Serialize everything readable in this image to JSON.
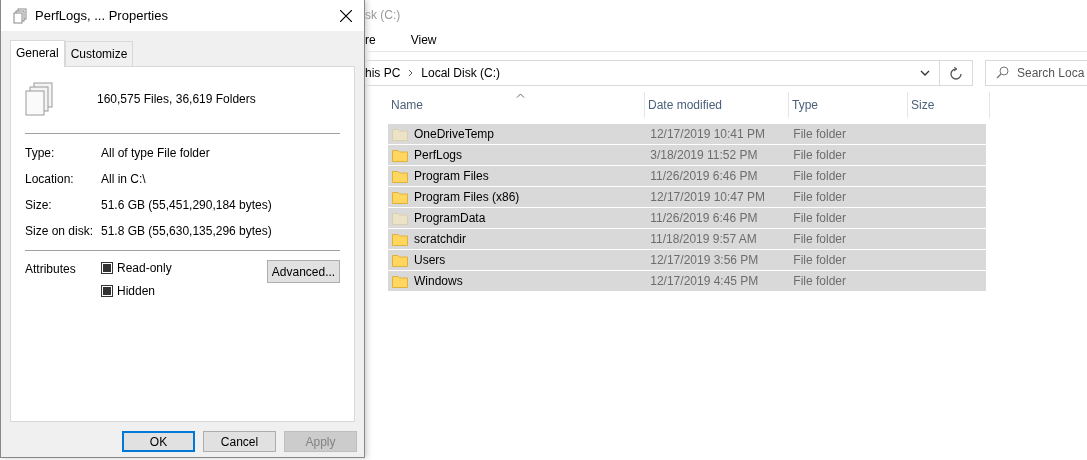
{
  "dialog": {
    "title": "PerfLogs, ... Properties",
    "tabs": [
      {
        "label": "General",
        "selected": true
      },
      {
        "label": "Customize",
        "selected": false
      }
    ],
    "summary": "160,575 Files, 36,619 Folders",
    "properties": [
      {
        "label": "Type:",
        "value": "All of type File folder"
      },
      {
        "label": "Location:",
        "value": "All in C:\\"
      },
      {
        "label": "Size:",
        "value": "51.6 GB (55,451,290,184 bytes)"
      },
      {
        "label": "Size on disk:",
        "value": "51.8 GB (55,630,135,296 bytes)"
      }
    ],
    "attributes": {
      "label": "Attributes",
      "items": [
        {
          "label": "Read-only",
          "mixed": true
        },
        {
          "label": "Hidden",
          "mixed": true
        }
      ]
    },
    "advanced_button": "Advanced...",
    "buttons": [
      {
        "label": "OK",
        "default": true,
        "disabled": false
      },
      {
        "label": "Cancel",
        "default": false,
        "disabled": false
      },
      {
        "label": "Apply",
        "default": false,
        "disabled": true
      }
    ]
  },
  "explorer": {
    "title": "sk (C:)",
    "ribbon_tabs": [
      "re",
      "View"
    ],
    "breadcrumb": [
      "his PC",
      "Local Disk (C:)"
    ],
    "search": {
      "placeholder": "Search Loca"
    },
    "columns": [
      {
        "label": "Name",
        "sorted": true
      },
      {
        "label": "Date modified",
        "sorted": false
      },
      {
        "label": "Type",
        "sorted": false
      },
      {
        "label": "Size",
        "sorted": false
      }
    ],
    "rows": [
      {
        "name": "OneDriveTemp",
        "date": "12/17/2019 10:41 PM",
        "type": "File folder",
        "hidden": true,
        "selected": true
      },
      {
        "name": "PerfLogs",
        "date": "3/18/2019 11:52 PM",
        "type": "File folder",
        "hidden": false,
        "selected": true
      },
      {
        "name": "Program Files",
        "date": "11/26/2019 6:46 PM",
        "type": "File folder",
        "hidden": false,
        "selected": true
      },
      {
        "name": "Program Files (x86)",
        "date": "12/17/2019 10:47 PM",
        "type": "File folder",
        "hidden": false,
        "selected": true
      },
      {
        "name": "ProgramData",
        "date": "11/26/2019 6:46 PM",
        "type": "File folder",
        "hidden": true,
        "selected": true
      },
      {
        "name": "scratchdir",
        "date": "11/18/2019 9:57 AM",
        "type": "File folder",
        "hidden": false,
        "selected": true
      },
      {
        "name": "Users",
        "date": "12/17/2019 3:56 PM",
        "type": "File folder",
        "hidden": false,
        "selected": true
      },
      {
        "name": "Windows",
        "date": "12/17/2019 4:45 PM",
        "type": "File folder",
        "hidden": false,
        "selected": true
      }
    ]
  }
}
